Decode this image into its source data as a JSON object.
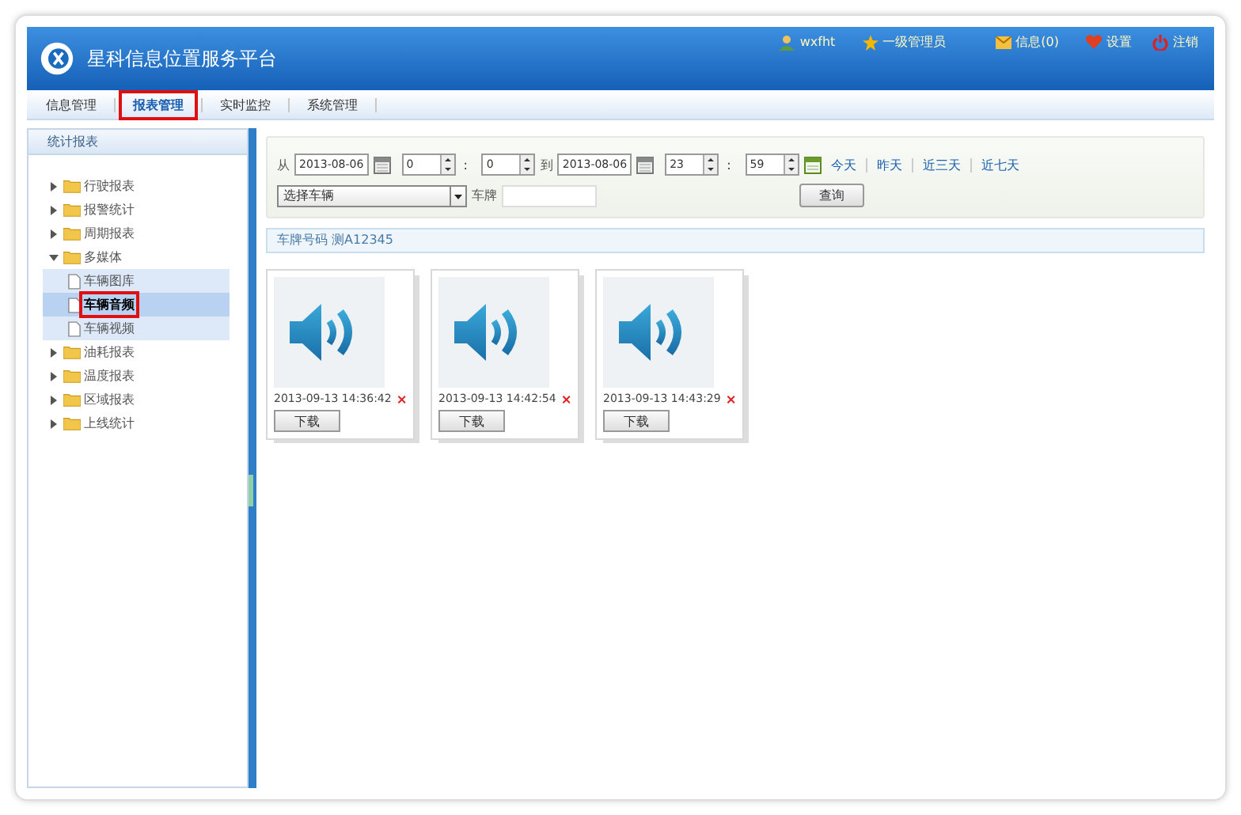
{
  "header": {
    "title": "星科信息位置服务平台",
    "user": "wxfht",
    "role": "一级管理员",
    "links": [
      {
        "kind": "mail",
        "label": "信息(0)"
      },
      {
        "kind": "heart",
        "label": "设置"
      },
      {
        "kind": "power",
        "label": "注销"
      }
    ]
  },
  "nav": [
    {
      "label": "信息管理",
      "selected": false
    },
    {
      "label": "报表管理",
      "selected": true
    },
    {
      "label": "实时监控",
      "selected": false
    },
    {
      "label": "系统管理",
      "selected": false
    }
  ],
  "sidebar": {
    "title": "统计报表",
    "items": [
      {
        "label": "行驶报表",
        "expanded": false
      },
      {
        "label": "报警统计",
        "expanded": false
      },
      {
        "label": "周期报表",
        "expanded": false
      },
      {
        "label": "多媒体",
        "expanded": true,
        "children": [
          {
            "label": "车辆图库",
            "selected": false
          },
          {
            "label": "车辆音频",
            "selected": true
          },
          {
            "label": "车辆视频",
            "selected": false
          }
        ]
      },
      {
        "label": "油耗报表",
        "expanded": false
      },
      {
        "label": "温度报表",
        "expanded": false
      },
      {
        "label": "区域报表",
        "expanded": false
      },
      {
        "label": "上线统计",
        "expanded": false
      }
    ]
  },
  "filter": {
    "from_label": "从",
    "start_date": "2013-08-06",
    "start_hour": "0",
    "start_minute": "0",
    "start_colon": ":",
    "end_colon": ":",
    "to_label": "到",
    "end_date": "2013-08-06",
    "end_hour": "23",
    "end_minute": "59",
    "quick_links": [
      "今天",
      "昨天",
      "近三天",
      "近七天"
    ],
    "vehicle_select": "选择车辆",
    "plate_label": "车牌",
    "query_button": "查询"
  },
  "info_bar": "车牌号码 测A12345",
  "cards": [
    {
      "time": "2013-09-13 14:36:42",
      "button": "下载"
    },
    {
      "time": "2013-09-13 14:42:54",
      "button": "下载"
    },
    {
      "time": "2013-09-13 14:43:29",
      "button": "下载"
    }
  ]
}
